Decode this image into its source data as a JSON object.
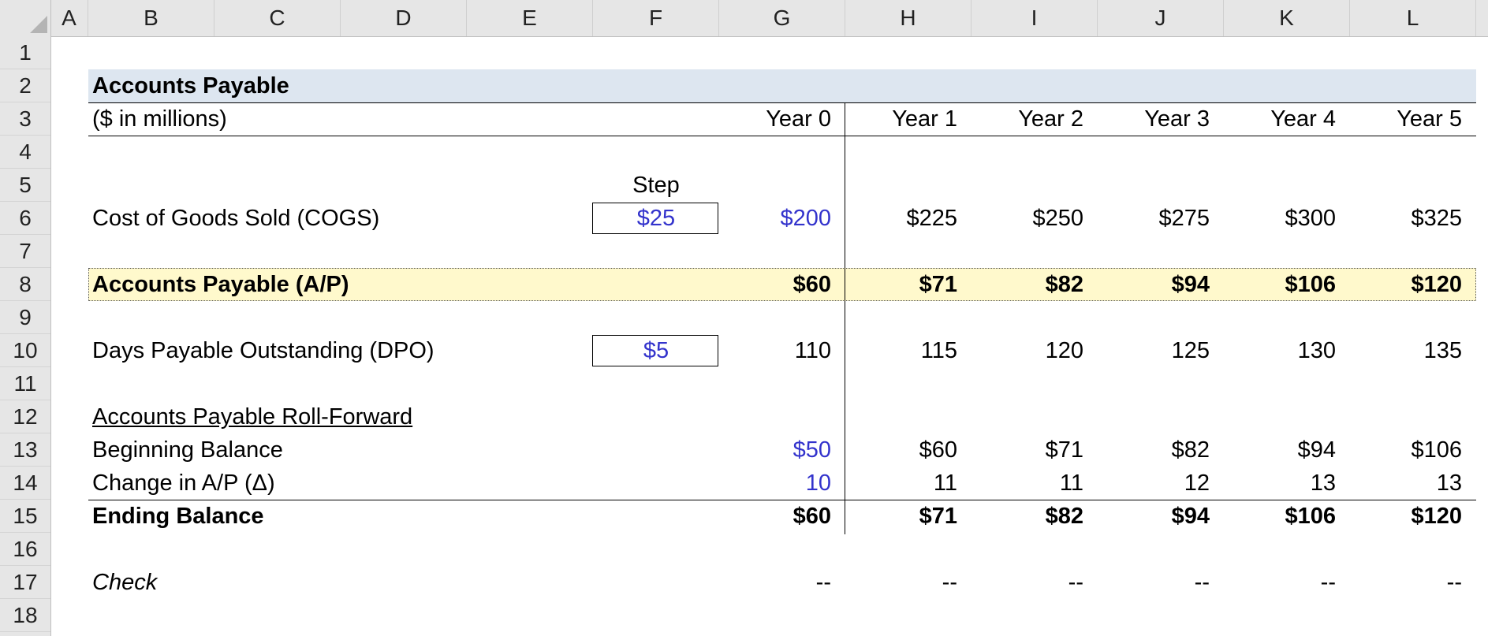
{
  "columns": [
    "A",
    "B",
    "C",
    "D",
    "E",
    "F",
    "G",
    "H",
    "I",
    "J",
    "K",
    "L"
  ],
  "rows": [
    "1",
    "2",
    "3",
    "4",
    "5",
    "6",
    "7",
    "8",
    "9",
    "10",
    "11",
    "12",
    "13",
    "14",
    "15",
    "16",
    "17",
    "18"
  ],
  "sheet": {
    "title": "Accounts Payable",
    "units": "($ in millions)",
    "years": [
      "Year 0",
      "Year 1",
      "Year 2",
      "Year 3",
      "Year 4",
      "Year 5"
    ],
    "step_header": "Step",
    "cogs": {
      "label": "Cost of Goods Sold (COGS)",
      "step": "$25",
      "values": [
        "$200",
        "$225",
        "$250",
        "$275",
        "$300",
        "$325"
      ]
    },
    "ap": {
      "label": "Accounts Payable (A/P)",
      "values": [
        "$60",
        "$71",
        "$82",
        "$94",
        "$106",
        "$120"
      ]
    },
    "dpo": {
      "label": "Days Payable Outstanding (DPO)",
      "step": "$5",
      "values": [
        "110",
        "115",
        "120",
        "125",
        "130",
        "135"
      ]
    },
    "rollforward": {
      "header": "Accounts Payable Roll-Forward",
      "beginning": {
        "label": "Beginning Balance",
        "values": [
          "$50",
          "$60",
          "$71",
          "$82",
          "$94",
          "$106"
        ]
      },
      "change": {
        "label": "Change in A/P (Δ)",
        "values": [
          "10",
          "11",
          "11",
          "12",
          "13",
          "13"
        ]
      },
      "ending": {
        "label": "Ending Balance",
        "values": [
          "$60",
          "$71",
          "$82",
          "$94",
          "$106",
          "$120"
        ]
      }
    },
    "check": {
      "label": "Check",
      "values": [
        "--",
        "--",
        "--",
        "--",
        "--",
        "--"
      ]
    }
  },
  "colors": {
    "input_blue": "#3333cc",
    "title_fill": "#dde6f0",
    "highlight_fill": "#fff9cc"
  }
}
